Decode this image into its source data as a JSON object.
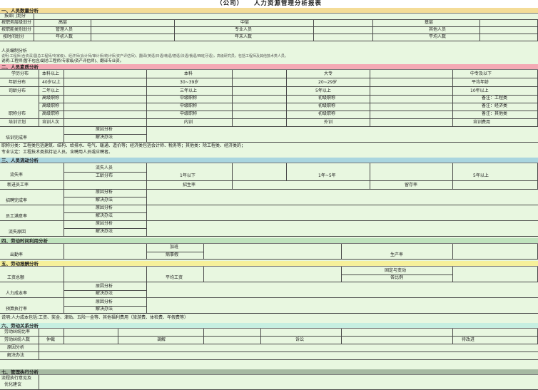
{
  "title": "（公司）　　人力资源管理分析报表",
  "sections": {
    "s1": "一、人员数量分析",
    "s2": "二、人员素质分析",
    "s3": "三、人员流动分析",
    "s4": "四、劳动时间利用分析",
    "s5": "五、劳动报酬分析",
    "s6": "六、劳动关系分析",
    "s7": "七、管理执行分析"
  },
  "s1": {
    "r1": "按部门划分",
    "r2": "按职务层级划分",
    "r2_cells": [
      "高层",
      "中层",
      "基层"
    ],
    "r3": "按职能类别划分",
    "r3_cells": [
      "管理人员",
      "专业人员",
      "其他人员"
    ],
    "r4": "按时间划分",
    "r4_cells": [
      "年初人数",
      "年末人数",
      "平均人数"
    ],
    "r5": "人员编制分析",
    "r6": "说明:工程师(含资深/副总工程师/专家级)、经济师(会计师/审计师/统计师/资产评估师)、翻译(英语/日语/韩语/德语/法语/俄语/西班牙语)，高级研究员，包括工程师及其他技术类人员。",
    "r7": "说明:工程师(暂不包含/副总工程师/专家级/资产评估师)、翻译专业资。"
  },
  "s2": {
    "r1": "学历分布",
    "r1_cells": [
      "本科以上",
      "本科",
      "大专",
      "中专及以下"
    ],
    "r2": "年龄分布",
    "r2_cells": [
      "40岁以上",
      "30~39岁",
      "20~29岁",
      "平均年龄"
    ],
    "r3": "司龄分布",
    "r3_cells": [
      "二年以上",
      "三年以上",
      "5年以上",
      "10年以上"
    ],
    "t1": [
      "高级职称",
      "中级职称",
      "初级职称",
      "备注：工程类"
    ],
    "t2": [
      "高级职称",
      "中级职称",
      "初级职称",
      "备注：经济类"
    ],
    "t3": [
      "高级职称",
      "中级职称",
      "初级职称",
      "备注：其他类"
    ],
    "r4": "职称分布",
    "r5": "培训计划",
    "r5_cells": [
      "培训人次",
      "内训",
      "外训",
      "培训费用"
    ],
    "r6": "培训完成率",
    "r6_cells": [
      "原因分析",
      "解决办法"
    ],
    "note1": "职称分类：工程类包括建筑、结构、给排水、电气、暖通、造价等；经济类包括会计师、税务等；其他类：除工程类、经济类的；",
    "note2": "专业认定：工程技术类指持证人员。含聘用人员或应聘者。"
  },
  "s3": {
    "r1": "流失率",
    "r1_cells": [
      "流失人员",
      "工龄分布",
      "1年以下",
      "1年~5年",
      "5年以上"
    ],
    "r2": "新进员工率",
    "r2_cells": [
      "招生率",
      "留存率"
    ],
    "r3": "招聘完成率",
    "r3_cells": [
      "原因分析",
      "解决办法"
    ],
    "r4": "员工满意率",
    "r4_cells": [
      "原因分析",
      "解决办法"
    ],
    "r5": "流失原因",
    "r5_cells": [
      "原因分析",
      "解决办法"
    ]
  },
  "s4": {
    "r1": "出勤率",
    "r1_cells": [
      "加班",
      "病事假",
      "生产率"
    ]
  },
  "s5": {
    "r1": "工资总额",
    "r1_cells": [
      "平均工资",
      "固定与变动",
      "各比例"
    ],
    "r2": "人力成本率",
    "r2_cells": [
      "原因分析",
      "解决办法"
    ],
    "r3": "预算执行率",
    "r3_cells": [
      "原因分析",
      "解决办法"
    ],
    "note": "说明:人力成本包括:工资、奖金、津贴、五险一金等、其他福利费用（旅游费、体检费、年假费等）"
  },
  "s6": {
    "r1": "劳动纠纷比率",
    "r2": "劳动纠纷人数",
    "r2_cells": [
      "仲裁",
      "调解",
      "诉讼",
      "待改进"
    ],
    "r3": "原因分析",
    "r4": "解决办法"
  },
  "s7": {
    "r1": "流程执行意见及",
    "r2": "优化建议"
  }
}
